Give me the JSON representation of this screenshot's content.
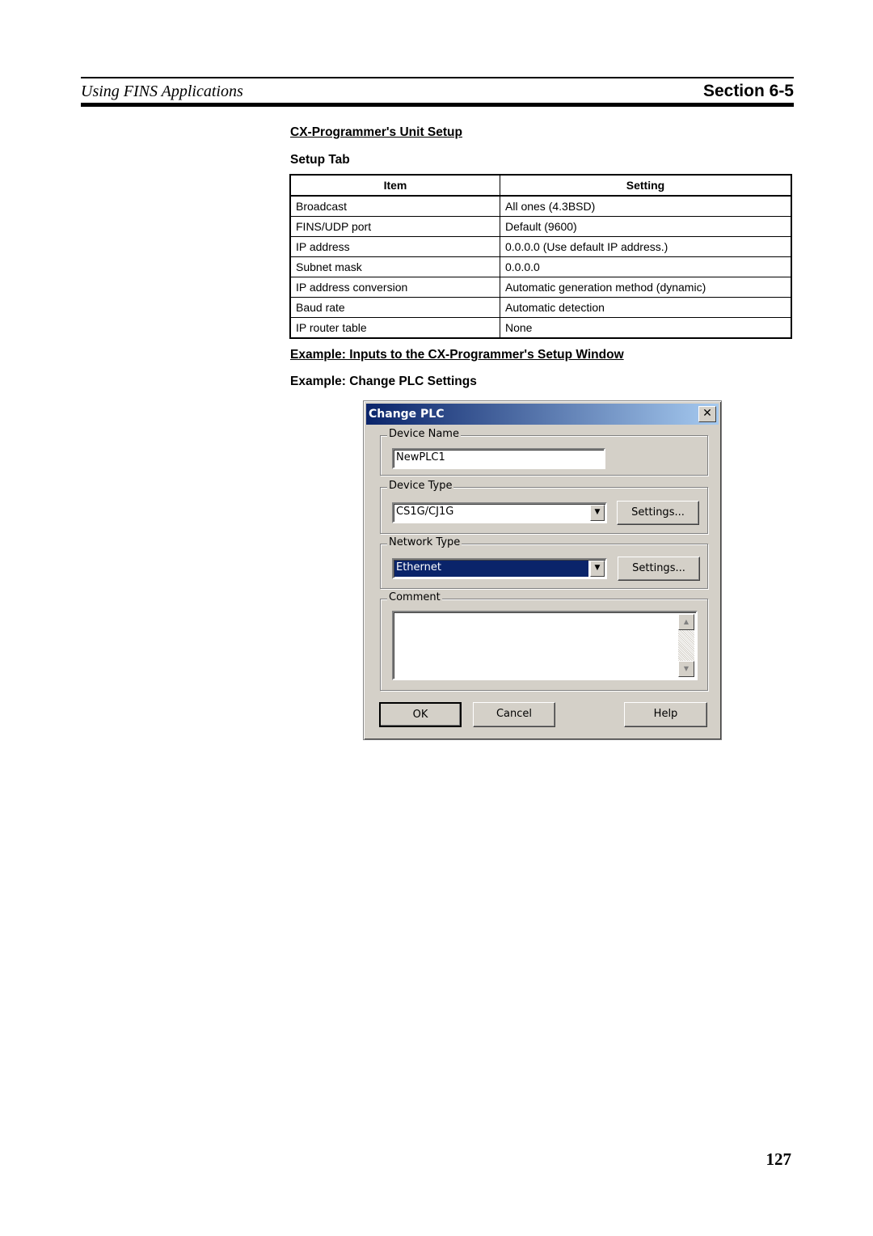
{
  "header": {
    "title": "Using FINS Applications",
    "section": "Section 6-5"
  },
  "headings": {
    "unit_setup": "CX-Programmer's Unit Setup",
    "setup_tab": "Setup Tab",
    "example_inputs": "Example: Inputs to the CX-Programmer's Setup Window",
    "example_change": "Example: Change PLC Settings"
  },
  "table": {
    "columns": [
      "Item",
      "Setting"
    ],
    "rows": [
      [
        "Broadcast",
        "All ones (4.3BSD)"
      ],
      [
        "FINS/UDP port",
        "Default (9600)"
      ],
      [
        "IP address",
        "0.0.0.0 (Use default IP address.)"
      ],
      [
        "Subnet mask",
        "0.0.0.0"
      ],
      [
        "IP address conversion",
        "Automatic generation method (dynamic)"
      ],
      [
        "Baud rate",
        "Automatic detection"
      ],
      [
        "IP router table",
        "None"
      ]
    ]
  },
  "dialog": {
    "title": "Change PLC",
    "close_glyph": "✕",
    "device_name_label": "Device Name",
    "device_name_value": "NewPLC1",
    "device_type_label": "Device Type",
    "device_type_value": "CS1G/CJ1G",
    "network_type_label": "Network Type",
    "network_type_value": "Ethernet",
    "settings_label": "Settings...",
    "comment_label": "Comment",
    "comment_value": "",
    "ok_label": "OK",
    "cancel_label": "Cancel",
    "help_label": "Help",
    "dropdown_glyph": "▼",
    "scroll_up_glyph": "▲",
    "scroll_down_glyph": "▼",
    "title_gradient": [
      "#0a246a",
      "#a6caf0"
    ],
    "selection_color": "#0a246a"
  },
  "page_number": "127"
}
